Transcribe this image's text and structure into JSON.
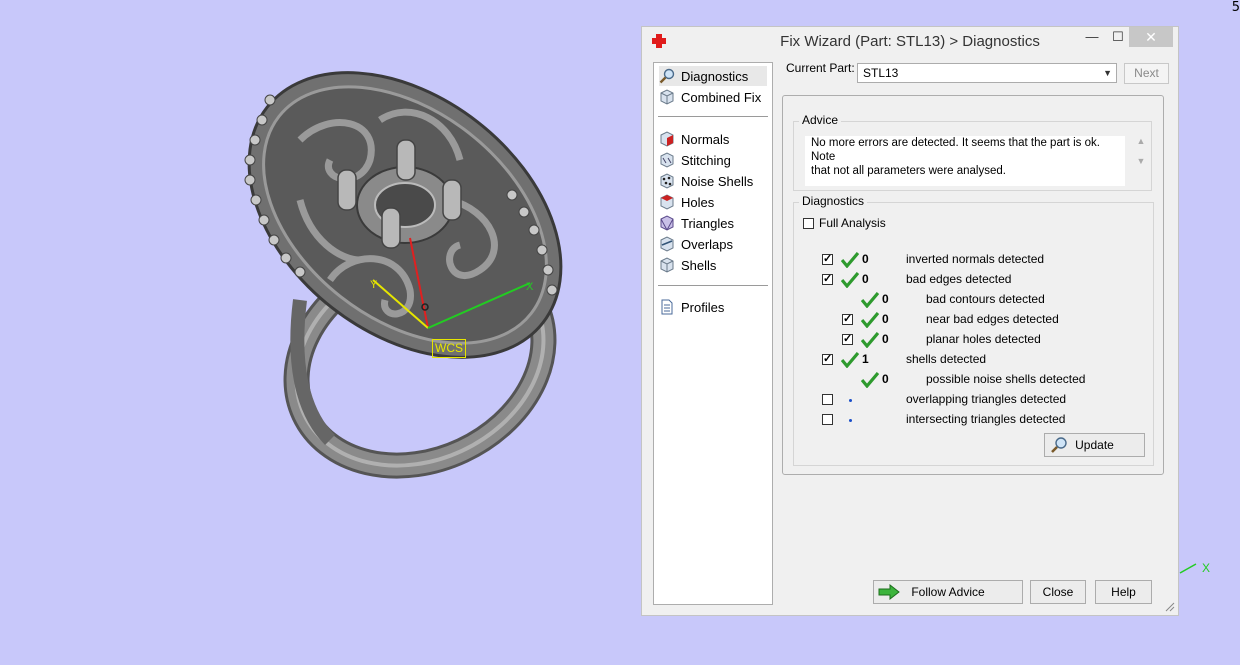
{
  "viewport": {
    "background_color": "#c8c8fa",
    "wcs_label": "WCS",
    "edge_glyph": "5"
  },
  "window": {
    "title": "Fix Wizard (Part: STL13) > Diagnostics",
    "minimize_glyph": "—",
    "maximize_glyph": "☐",
    "close_glyph": "✕"
  },
  "nav": {
    "items": [
      {
        "label": "Diagnostics",
        "icon": "magnifier-icon"
      },
      {
        "label": "Combined Fix",
        "icon": "cube-icon"
      },
      {
        "label": "Normals",
        "icon": "normals-cube-icon"
      },
      {
        "label": "Stitching",
        "icon": "stitching-cube-icon"
      },
      {
        "label": "Noise Shells",
        "icon": "noise-shells-icon"
      },
      {
        "label": "Holes",
        "icon": "holes-cube-icon"
      },
      {
        "label": "Triangles",
        "icon": "triangles-cube-icon"
      },
      {
        "label": "Overlaps",
        "icon": "overlaps-cube-icon"
      },
      {
        "label": "Shells",
        "icon": "shells-cube-icon"
      },
      {
        "label": "Profiles",
        "icon": "document-icon"
      }
    ]
  },
  "current_part": {
    "label": "Current Part:",
    "value": "STL13",
    "next_label": "Next"
  },
  "advice": {
    "title": "Advice",
    "line1": "No more errors are detected. It seems that the part is ok. Note",
    "line2": "that not all parameters were analysed."
  },
  "diagnostics": {
    "title": "Diagnostics",
    "full_analysis_label": "Full Analysis",
    "full_analysis_checked": false,
    "rows": [
      {
        "checked": true,
        "status": "ok",
        "count": "0",
        "label": "inverted normals detected",
        "indent": 0
      },
      {
        "checked": true,
        "status": "ok",
        "count": "0",
        "label": "bad edges detected",
        "indent": 0
      },
      {
        "checked": null,
        "status": "ok",
        "count": "0",
        "label": "bad contours detected",
        "indent": 1
      },
      {
        "checked": true,
        "status": "ok",
        "count": "0",
        "label": "near bad edges detected",
        "indent": 1
      },
      {
        "checked": true,
        "status": "ok",
        "count": "0",
        "label": "planar holes detected",
        "indent": 1
      },
      {
        "checked": true,
        "status": "ok",
        "count": "1",
        "label": "shells detected",
        "indent": 0
      },
      {
        "checked": null,
        "status": "ok",
        "count": "0",
        "label": "possible noise shells detected",
        "indent": 1
      },
      {
        "checked": false,
        "status": "pending",
        "count": "",
        "label": "overlapping triangles detected",
        "indent": 0
      },
      {
        "checked": false,
        "status": "pending",
        "count": "",
        "label": "intersecting triangles detected",
        "indent": 0
      }
    ],
    "update_label": "Update"
  },
  "footer": {
    "follow_label": "Follow Advice",
    "close_label": "Close",
    "help_label": "Help"
  },
  "colors": {
    "check_green": "#2e9a2e",
    "axis_red": "#e02020",
    "axis_yellow": "#e6e600",
    "axis_green": "#22cc22",
    "ring_metal": "#6e6e6e"
  }
}
